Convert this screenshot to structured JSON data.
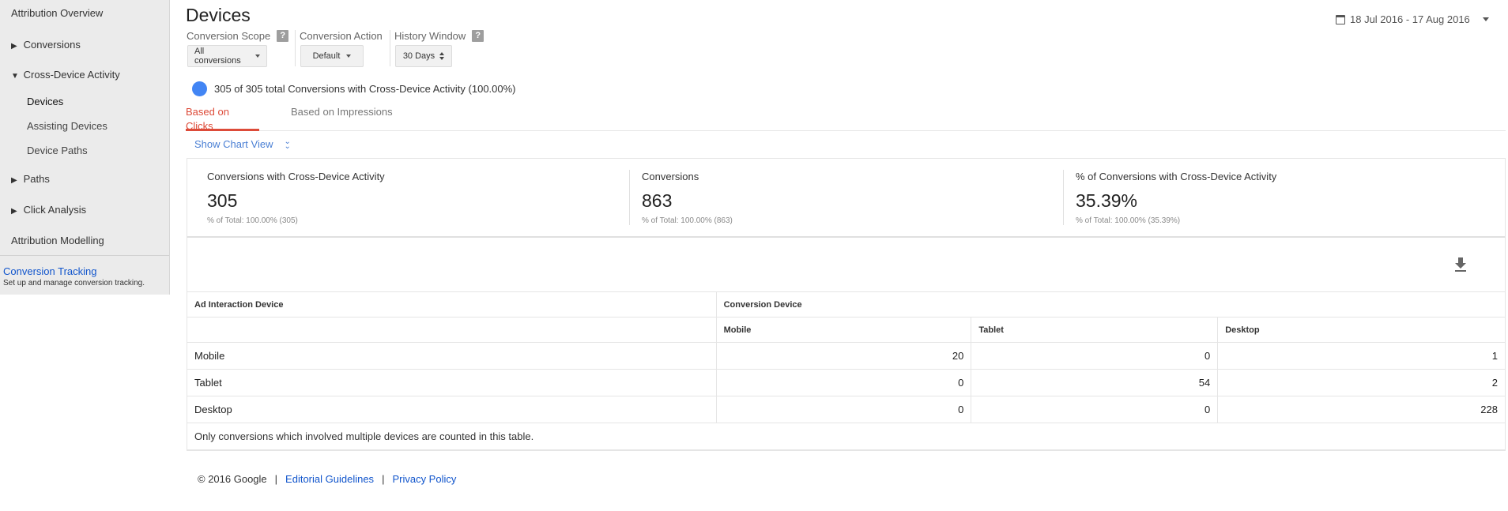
{
  "sidebar": {
    "items": [
      {
        "label": "Attribution Overview"
      },
      {
        "label": "Conversions"
      },
      {
        "label": "Cross-Device Activity"
      },
      {
        "label": "Devices"
      },
      {
        "label": "Assisting Devices"
      },
      {
        "label": "Device Paths"
      },
      {
        "label": "Paths"
      },
      {
        "label": "Click Analysis"
      },
      {
        "label": "Attribution Modelling"
      }
    ],
    "collapsed_glyph": "▶",
    "expanded_glyph": "▼",
    "tracking_link": "Conversion Tracking",
    "tracking_desc": "Set up and manage conversion tracking."
  },
  "header": {
    "title": "Devices",
    "date_range": "18 Jul 2016 - 17 Aug 2016"
  },
  "controls": {
    "scope_label": "Conversion Scope",
    "scope_value": "All conversions",
    "action_label": "Conversion Action",
    "action_value": "Default",
    "history_label": "History Window",
    "history_value": "30 Days",
    "help_glyph": "?"
  },
  "summary": {
    "text": "305 of 305 total Conversions with Cross-Device Activity (100.00%)",
    "dot_color": "#4285f4"
  },
  "tabs": [
    {
      "label": "Based on Clicks",
      "active": true
    },
    {
      "label": "Based on Impressions",
      "active": false
    }
  ],
  "chart_link": "Show Chart View",
  "metrics": [
    {
      "label": "Conversions with Cross-Device Activity",
      "value": "305",
      "sub": "% of Total: 100.00% (305)"
    },
    {
      "label": "Conversions",
      "value": "863",
      "sub": "% of Total: 100.00% (863)"
    },
    {
      "label": "% of Conversions with Cross-Device Activity",
      "value": "35.39%",
      "sub": "% of Total: 100.00% (35.39%)"
    }
  ],
  "table": {
    "row_header": "Ad Interaction Device",
    "group_header": "Conversion Device",
    "columns": [
      "Mobile",
      "Tablet",
      "Desktop"
    ],
    "rows": [
      {
        "device": "Mobile",
        "values": [
          "20",
          "0",
          "1"
        ]
      },
      {
        "device": "Tablet",
        "values": [
          "0",
          "54",
          "2"
        ]
      },
      {
        "device": "Desktop",
        "values": [
          "0",
          "0",
          "228"
        ]
      }
    ],
    "note": "Only conversions which involved multiple devices are counted in this table."
  },
  "footer": {
    "copyright": "© 2016 Google",
    "separator": "|",
    "links": [
      "Editorial Guidelines",
      "Privacy Policy"
    ]
  },
  "colors": {
    "accent_red": "#dd4b39",
    "link_blue": "#1155cc"
  }
}
